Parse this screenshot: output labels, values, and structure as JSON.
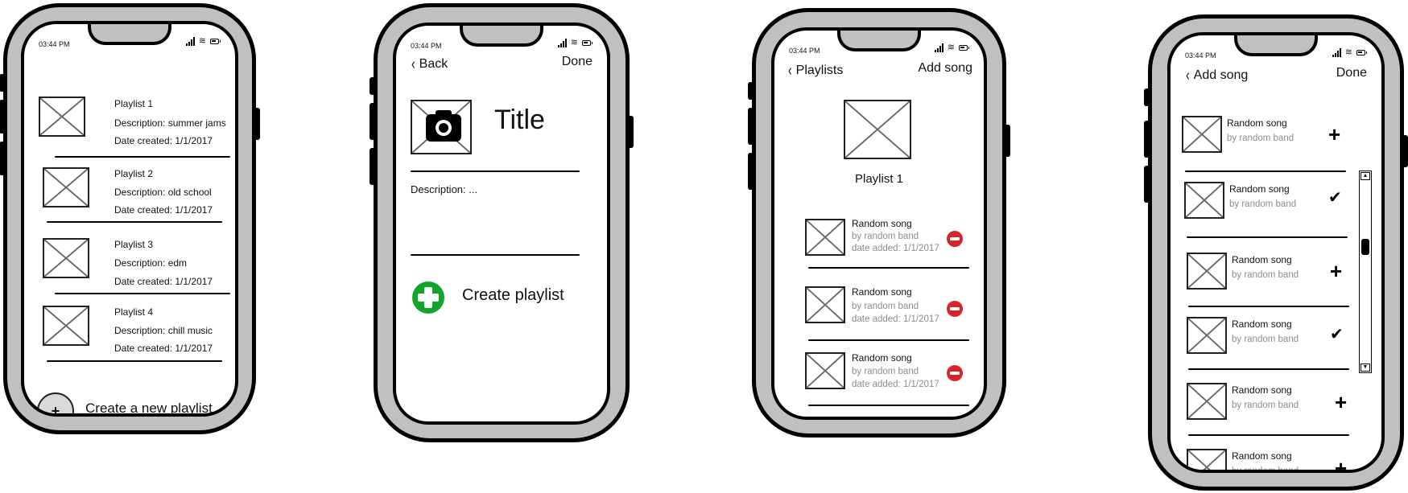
{
  "status_bar": {
    "time": "03:44 PM"
  },
  "screen1": {
    "playlists": [
      {
        "name": "Playlist 1",
        "description": "Description: summer jams",
        "date": "Date created: 1/1/2017"
      },
      {
        "name": "Playlist 2",
        "description": "Description:  old school",
        "date": "Date created: 1/1/2017"
      },
      {
        "name": "Playlist 3",
        "description": "Description: edm",
        "date": "Date created: 1/1/2017"
      },
      {
        "name": "Playlist 4",
        "description": "Description: chill music",
        "date": "Date created: 1/1/2017"
      }
    ],
    "create_icon": "+",
    "create_label": "Create a new playlist"
  },
  "screen2": {
    "back_label": "Back",
    "done_label": "Done",
    "title": "Title",
    "description_placeholder": "Description: ...",
    "create_label": "Create playlist",
    "accent": "#13a52b"
  },
  "screen3": {
    "back_label": "Playlists",
    "add_label": "Add song",
    "playlist_name": "Playlist 1",
    "songs": [
      {
        "title": "Random song",
        "artist": "by random band",
        "date": "date added: 1/1/2017"
      },
      {
        "title": "Random song",
        "artist": "by random band",
        "date": "date added: 1/1/2017"
      },
      {
        "title": "Random song",
        "artist": "by random band",
        "date": "date added: 1/1/2017"
      }
    ],
    "remove_color": "#d1272b"
  },
  "screen4": {
    "back_label": "Add song",
    "done_label": "Done",
    "songs": [
      {
        "title": "Random song",
        "artist": "by random band",
        "state": "add",
        "glyph": "+"
      },
      {
        "title": "Random song",
        "artist": "by random band",
        "state": "added",
        "glyph": "✔"
      },
      {
        "title": "Random song",
        "artist": "by random band",
        "state": "add",
        "glyph": "+"
      },
      {
        "title": "Random song",
        "artist": "by random band",
        "state": "added",
        "glyph": "✔"
      },
      {
        "title": "Random song",
        "artist": "by random band",
        "state": "add",
        "glyph": "+"
      },
      {
        "title": "Random song",
        "artist": "by random band",
        "state": "add",
        "glyph": "+"
      }
    ],
    "scroll_up": "▲",
    "scroll_down": "▼"
  },
  "icons": {
    "wifi": "wifi-icon",
    "signal": "signal-icon",
    "battery": "battery-icon",
    "back": "‹"
  }
}
